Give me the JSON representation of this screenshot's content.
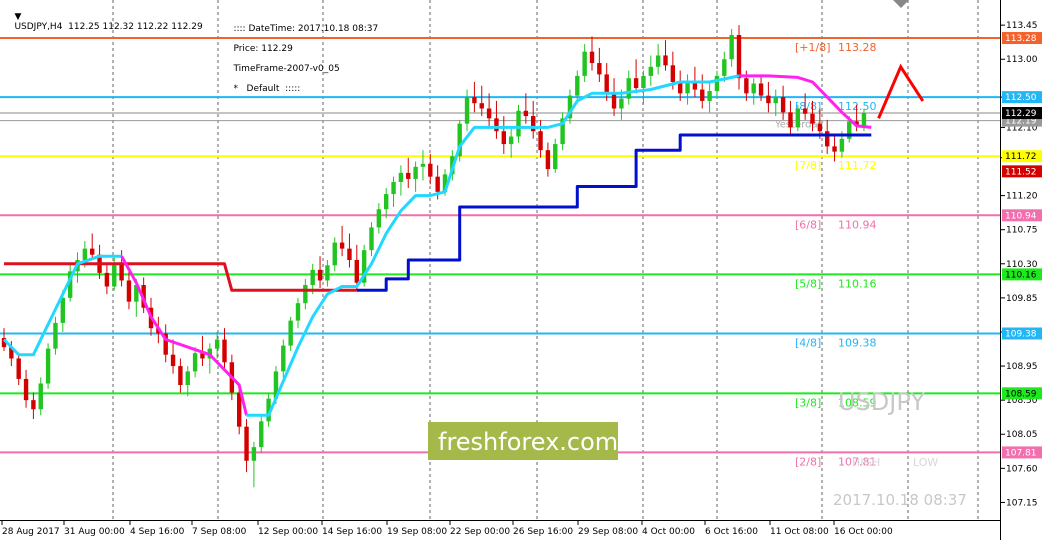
{
  "header": {
    "symbol_info": "USDJPY,H4  112.25 112.32 112.22 112.29",
    "datetime": ":::: DateTime: 2017.10.18 08:37",
    "price": "Price: 112.29",
    "timeframe": "TimeFrame-2007-v0_05",
    "default": "*   Default  :::::"
  },
  "watermark": {
    "symbol": "USDJPY",
    "brand": "freshforex.com",
    "timestamp": "2017.10.18 08:37",
    "high_label": "HIGH",
    "low_label": "LOW",
    "yesterday_label": "Yesterday"
  },
  "colors": {
    "bull": "#22c422",
    "bear": "#d40000",
    "fast_up": "#22d8ff",
    "fast_down": "#ff22ee",
    "slow_up": "#0010cc",
    "slow_down": "#dd1020",
    "signal": "#ff0000"
  },
  "price_axis": [
    "113.45",
    "113.00",
    "112.50",
    "112.10",
    "111.70",
    "111.20",
    "110.75",
    "110.30",
    "109.85",
    "109.40",
    "108.95",
    "108.50",
    "108.05",
    "107.60",
    "107.15"
  ],
  "level_tags": [
    {
      "value": 113.28,
      "text": "113.28",
      "color": "#f4622c"
    },
    {
      "value": 112.5,
      "text": "112.50",
      "color": "#21b6f6"
    },
    {
      "value": 112.19,
      "text": "112.19",
      "color": "#9a9a9a"
    },
    {
      "value": 112.29,
      "text": "112.29",
      "color": "#000000"
    },
    {
      "value": 111.72,
      "text": "111.72",
      "color": "#ffff00"
    },
    {
      "value": 111.52,
      "text": "111.52",
      "color": "#d40000"
    },
    {
      "value": 110.94,
      "text": "110.94",
      "color": "#f26fae"
    },
    {
      "value": 110.16,
      "text": "110.16",
      "color": "#1ee81e"
    },
    {
      "value": 109.38,
      "text": "109.38",
      "color": "#21b6f6"
    },
    {
      "value": 108.59,
      "text": "108.59",
      "color": "#1ee81e"
    },
    {
      "value": 107.81,
      "text": "107.81",
      "color": "#f26fae"
    }
  ],
  "murrey_levels": [
    {
      "label": "[+1/8]",
      "value": 113.28,
      "value_text": "113.28",
      "color": "#f4622c",
      "dashed": false
    },
    {
      "label": "[8/8]",
      "value": 112.5,
      "value_text": "112.50",
      "color": "#21b6f6",
      "dashed": false
    },
    {
      "label": "[7/8]",
      "value": 111.72,
      "value_text": "111.72",
      "color": "#ffff00",
      "dashed": false
    },
    {
      "label": "[6/8]",
      "value": 110.94,
      "value_text": "110.94",
      "color": "#f26fae",
      "dashed": false
    },
    {
      "label": "[5/8]",
      "value": 110.16,
      "value_text": "110.16",
      "color": "#1ee81e",
      "dashed": false
    },
    {
      "label": "[4/8]",
      "value": 109.38,
      "value_text": "109.38",
      "color": "#21b6f6",
      "dashed": false
    },
    {
      "label": "[3/8]",
      "value": 108.59,
      "value_text": "108.59",
      "color": "#1ee81e",
      "dashed": false
    },
    {
      "label": "[2/8]",
      "value": 107.81,
      "value_text": "107.81",
      "color": "#f26fae",
      "dashed": false
    }
  ],
  "time_labels": [
    "28 Aug 2017",
    "31 Aug 00:00",
    "4 Sep 16:00",
    "7 Sep 08:00",
    "12 Sep 00:00",
    "14 Sep 16:00",
    "19 Sep 08:00",
    "22 Sep 00:00",
    "26 Sep 16:00",
    "29 Sep 08:00",
    "4 Oct 00:00",
    "6 Oct 16:00",
    "11 Oct 08:00",
    "16 Oct 00:00"
  ],
  "chart_data": {
    "type": "candlestick",
    "symbol": "USDJPY",
    "timeframe": "H4",
    "ylim": [
      107.05,
      113.65
    ],
    "current_price": 112.29,
    "candles": [
      [
        109.32,
        109.45,
        109.15,
        109.2
      ],
      [
        109.2,
        109.28,
        108.95,
        109.05
      ],
      [
        109.05,
        109.1,
        108.7,
        108.78
      ],
      [
        108.78,
        108.9,
        108.4,
        108.5
      ],
      [
        108.5,
        108.6,
        108.25,
        108.38
      ],
      [
        108.38,
        108.8,
        108.3,
        108.72
      ],
      [
        108.72,
        109.25,
        108.65,
        109.18
      ],
      [
        109.18,
        109.6,
        109.1,
        109.52
      ],
      [
        109.52,
        109.95,
        109.4,
        109.85
      ],
      [
        109.85,
        110.3,
        109.8,
        110.2
      ],
      [
        110.2,
        110.45,
        110.05,
        110.35
      ],
      [
        110.35,
        110.6,
        110.25,
        110.5
      ],
      [
        110.5,
        110.7,
        110.35,
        110.42
      ],
      [
        110.42,
        110.55,
        110.1,
        110.18
      ],
      [
        110.18,
        110.3,
        109.9,
        110.0
      ],
      [
        110.0,
        110.4,
        109.95,
        110.3
      ],
      [
        110.3,
        110.48,
        110.0,
        110.08
      ],
      [
        110.08,
        110.2,
        109.7,
        109.8
      ],
      [
        109.8,
        110.1,
        109.6,
        110.02
      ],
      [
        110.02,
        110.12,
        109.65,
        109.72
      ],
      [
        109.72,
        109.85,
        109.35,
        109.45
      ],
      [
        109.45,
        109.6,
        109.25,
        109.38
      ],
      [
        109.38,
        109.5,
        109.0,
        109.1
      ],
      [
        109.1,
        109.3,
        108.85,
        108.95
      ],
      [
        108.95,
        109.05,
        108.6,
        108.7
      ],
      [
        108.7,
        108.95,
        108.55,
        108.88
      ],
      [
        108.88,
        109.2,
        108.8,
        109.12
      ],
      [
        109.12,
        109.35,
        108.95,
        109.05
      ],
      [
        109.05,
        109.25,
        108.85,
        109.18
      ],
      [
        109.18,
        109.4,
        109.05,
        109.3
      ],
      [
        109.3,
        109.45,
        108.9,
        109.0
      ],
      [
        109.0,
        109.1,
        108.5,
        108.6
      ],
      [
        108.6,
        108.7,
        108.05,
        108.15
      ],
      [
        108.15,
        108.25,
        107.55,
        107.7
      ],
      [
        107.7,
        107.95,
        107.35,
        107.88
      ],
      [
        107.88,
        108.3,
        107.8,
        108.22
      ],
      [
        108.22,
        108.6,
        108.15,
        108.52
      ],
      [
        108.52,
        108.95,
        108.45,
        108.88
      ],
      [
        108.88,
        109.3,
        108.8,
        109.22
      ],
      [
        109.22,
        109.6,
        109.15,
        109.55
      ],
      [
        109.55,
        109.85,
        109.45,
        109.78
      ],
      [
        109.78,
        110.1,
        109.7,
        110.02
      ],
      [
        110.02,
        110.3,
        109.9,
        110.22
      ],
      [
        110.22,
        110.4,
        109.98,
        110.08
      ],
      [
        110.08,
        110.35,
        110.0,
        110.28
      ],
      [
        110.28,
        110.65,
        110.2,
        110.58
      ],
      [
        110.58,
        110.8,
        110.4,
        110.5
      ],
      [
        110.5,
        110.7,
        110.25,
        110.35
      ],
      [
        110.35,
        110.55,
        109.95,
        110.05
      ],
      [
        110.05,
        110.55,
        110.0,
        110.48
      ],
      [
        110.48,
        110.85,
        110.4,
        110.78
      ],
      [
        110.78,
        111.1,
        110.7,
        111.02
      ],
      [
        111.02,
        111.3,
        110.9,
        111.22
      ],
      [
        111.22,
        111.45,
        111.05,
        111.38
      ],
      [
        111.38,
        111.6,
        111.2,
        111.5
      ],
      [
        111.5,
        111.7,
        111.3,
        111.42
      ],
      [
        111.42,
        111.65,
        111.25,
        111.58
      ],
      [
        111.58,
        111.8,
        111.4,
        111.62
      ],
      [
        111.62,
        111.75,
        111.35,
        111.45
      ],
      [
        111.45,
        111.6,
        111.15,
        111.25
      ],
      [
        111.25,
        111.55,
        111.2,
        111.48
      ],
      [
        111.48,
        111.8,
        111.4,
        111.72
      ],
      [
        111.72,
        112.2,
        111.65,
        112.15
      ],
      [
        112.15,
        112.6,
        112.05,
        112.5
      ],
      [
        112.5,
        112.7,
        112.3,
        112.42
      ],
      [
        112.42,
        112.65,
        112.25,
        112.35
      ],
      [
        112.35,
        112.55,
        112.1,
        112.22
      ],
      [
        112.22,
        112.45,
        111.95,
        112.05
      ],
      [
        112.05,
        112.25,
        111.75,
        111.88
      ],
      [
        111.88,
        112.1,
        111.7,
        111.98
      ],
      [
        111.98,
        112.4,
        111.9,
        112.32
      ],
      [
        112.32,
        112.55,
        112.15,
        112.25
      ],
      [
        112.25,
        112.45,
        111.95,
        112.05
      ],
      [
        112.05,
        112.2,
        111.7,
        111.8
      ],
      [
        111.8,
        111.9,
        111.45,
        111.55
      ],
      [
        111.55,
        111.95,
        111.5,
        111.88
      ],
      [
        111.88,
        112.3,
        111.8,
        112.22
      ],
      [
        112.22,
        112.6,
        112.15,
        112.52
      ],
      [
        112.52,
        112.85,
        112.45,
        112.78
      ],
      [
        112.78,
        113.2,
        112.7,
        113.1
      ],
      [
        113.1,
        113.3,
        112.85,
        112.95
      ],
      [
        112.95,
        113.15,
        112.7,
        112.8
      ],
      [
        112.8,
        112.95,
        112.45,
        112.55
      ],
      [
        112.55,
        112.75,
        112.25,
        112.35
      ],
      [
        112.35,
        112.6,
        112.2,
        112.48
      ],
      [
        112.48,
        112.85,
        112.4,
        112.75
      ],
      [
        112.75,
        113.0,
        112.55,
        112.62
      ],
      [
        112.62,
        112.85,
        112.4,
        112.78
      ],
      [
        112.78,
        113.05,
        112.65,
        112.9
      ],
      [
        112.9,
        113.2,
        112.8,
        113.05
      ],
      [
        113.05,
        113.25,
        112.85,
        112.92
      ],
      [
        112.92,
        113.1,
        112.6,
        112.7
      ],
      [
        112.7,
        112.85,
        112.45,
        112.55
      ],
      [
        112.55,
        112.8,
        112.4,
        112.68
      ],
      [
        112.68,
        112.9,
        112.5,
        112.6
      ],
      [
        112.6,
        112.8,
        112.35,
        112.45
      ],
      [
        112.45,
        112.7,
        112.3,
        112.58
      ],
      [
        112.58,
        112.85,
        112.5,
        112.78
      ],
      [
        112.78,
        113.1,
        112.7,
        113.0
      ],
      [
        113.0,
        113.4,
        112.9,
        113.32
      ],
      [
        113.32,
        113.45,
        112.6,
        112.75
      ],
      [
        112.75,
        112.85,
        112.45,
        112.55
      ],
      [
        112.55,
        112.75,
        112.4,
        112.68
      ],
      [
        112.68,
        112.8,
        112.45,
        112.52
      ],
      [
        112.52,
        112.7,
        112.3,
        112.42
      ],
      [
        112.42,
        112.6,
        112.25,
        112.5
      ],
      [
        112.5,
        112.65,
        112.2,
        112.3
      ],
      [
        112.3,
        112.45,
        112.0,
        112.1
      ],
      [
        112.1,
        112.4,
        112.05,
        112.35
      ],
      [
        112.35,
        112.55,
        112.2,
        112.28
      ],
      [
        112.28,
        112.45,
        112.05,
        112.15
      ],
      [
        112.15,
        112.35,
        111.95,
        112.05
      ],
      [
        112.05,
        112.2,
        111.75,
        111.85
      ],
      [
        111.85,
        112.0,
        111.65,
        111.78
      ],
      [
        111.78,
        112.05,
        111.7,
        111.95
      ],
      [
        111.95,
        112.25,
        111.9,
        112.18
      ],
      [
        112.18,
        112.4,
        112.05,
        112.12
      ],
      [
        112.12,
        112.35,
        112.05,
        112.29
      ]
    ],
    "indicators": {
      "fast_line": {
        "label": "fast trailing line",
        "segments": [
          {
            "trend": "up",
            "points": [
              [
                0,
                109.3
              ],
              [
                2,
                109.1
              ],
              [
                4,
                109.1
              ],
              [
                6,
                109.5
              ],
              [
                8,
                109.9
              ],
              [
                10,
                110.3
              ],
              [
                13,
                110.4
              ],
              [
                16,
                110.4
              ]
            ]
          },
          {
            "trend": "down",
            "points": [
              [
                16,
                110.4
              ],
              [
                18,
                110.05
              ],
              [
                20,
                109.6
              ],
              [
                22,
                109.3
              ],
              [
                25,
                109.2
              ],
              [
                28,
                109.1
              ],
              [
                30,
                108.9
              ],
              [
                32,
                108.7
              ],
              [
                33,
                108.3
              ]
            ]
          },
          {
            "trend": "up",
            "points": [
              [
                33,
                108.3
              ],
              [
                36,
                108.3
              ],
              [
                38,
                108.75
              ],
              [
                40,
                109.2
              ],
              [
                42,
                109.6
              ],
              [
                44,
                109.9
              ],
              [
                46,
                110.0
              ],
              [
                48,
                110.0
              ],
              [
                50,
                110.3
              ],
              [
                52,
                110.7
              ],
              [
                54,
                111.0
              ],
              [
                56,
                111.2
              ],
              [
                58,
                111.2
              ],
              [
                60,
                111.25
              ],
              [
                62,
                111.85
              ],
              [
                64,
                112.1
              ],
              [
                66,
                112.1
              ],
              [
                68,
                112.1
              ],
              [
                70,
                112.1
              ],
              [
                72,
                112.1
              ],
              [
                74,
                112.1
              ],
              [
                76,
                112.15
              ],
              [
                78,
                112.45
              ],
              [
                80,
                112.55
              ],
              [
                84,
                112.55
              ],
              [
                88,
                112.6
              ],
              [
                92,
                112.7
              ],
              [
                96,
                112.7
              ],
              [
                100,
                112.78
              ]
            ]
          },
          {
            "trend": "down",
            "points": [
              [
                100,
                112.78
              ],
              [
                104,
                112.78
              ],
              [
                108,
                112.76
              ],
              [
                110,
                112.7
              ],
              [
                112,
                112.5
              ],
              [
                114,
                112.3
              ],
              [
                116,
                112.12
              ],
              [
                118,
                112.1
              ]
            ]
          }
        ]
      },
      "slow_line": {
        "label": "slow trailing line",
        "segments": [
          {
            "trend": "down",
            "points": [
              [
                0,
                110.3
              ],
              [
                30,
                110.3
              ],
              [
                31,
                109.95
              ],
              [
                48,
                109.95
              ]
            ]
          },
          {
            "trend": "up",
            "points": [
              [
                48,
                109.95
              ],
              [
                52,
                109.95
              ],
              [
                52,
                110.1
              ],
              [
                55,
                110.1
              ],
              [
                55,
                110.35
              ],
              [
                62,
                110.35
              ],
              [
                62,
                111.05
              ],
              [
                78,
                111.05
              ],
              [
                78,
                111.32
              ],
              [
                86,
                111.32
              ],
              [
                86,
                111.8
              ],
              [
                92,
                111.8
              ],
              [
                92,
                112.0
              ],
              [
                104,
                112.0
              ],
              [
                118,
                112.0
              ]
            ]
          }
        ]
      },
      "signal_arrow": {
        "direction": "up",
        "points": [
          [
            119,
            112.22
          ],
          [
            122,
            112.9
          ],
          [
            125,
            112.45
          ]
        ]
      }
    }
  }
}
